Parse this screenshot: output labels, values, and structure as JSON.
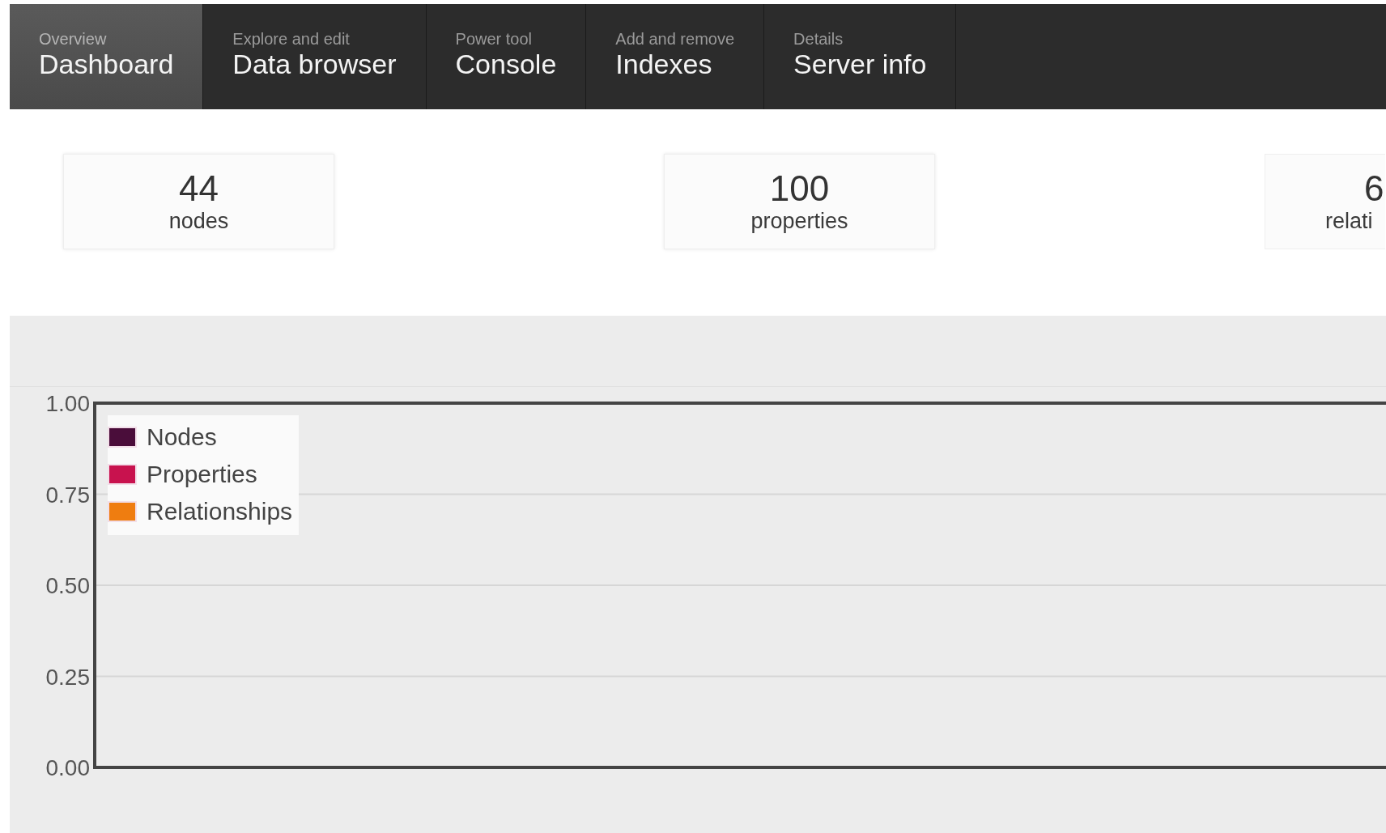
{
  "tabs": [
    {
      "caption": "Overview",
      "label": "Dashboard",
      "selected": true
    },
    {
      "caption": "Explore and edit",
      "label": "Data browser",
      "selected": false
    },
    {
      "caption": "Power tool",
      "label": "Console",
      "selected": false
    },
    {
      "caption": "Add and remove",
      "label": "Indexes",
      "selected": false
    },
    {
      "caption": "Details",
      "label": "Server info",
      "selected": false
    }
  ],
  "stats": [
    {
      "value": "44",
      "label": "nodes"
    },
    {
      "value": "100",
      "label": "properties"
    },
    {
      "value": "6",
      "label": "relati"
    }
  ],
  "chart": {
    "chart_data": {
      "type": "line",
      "grid": true,
      "ylim": [
        0,
        1
      ],
      "yticks": [
        {
          "value": 0,
          "label": "0.00"
        },
        {
          "value": 0.25,
          "label": "0.25"
        },
        {
          "value": 0.5,
          "label": "0.50"
        },
        {
          "value": 0.75,
          "label": "0.75"
        },
        {
          "value": 1,
          "label": "1.00"
        }
      ],
      "series": [
        {
          "name": "Nodes",
          "color": "#4a0d3a"
        },
        {
          "name": "Properties",
          "color": "#c8124e"
        },
        {
          "name": "Relationships",
          "color": "#ef7d10"
        }
      ]
    }
  }
}
